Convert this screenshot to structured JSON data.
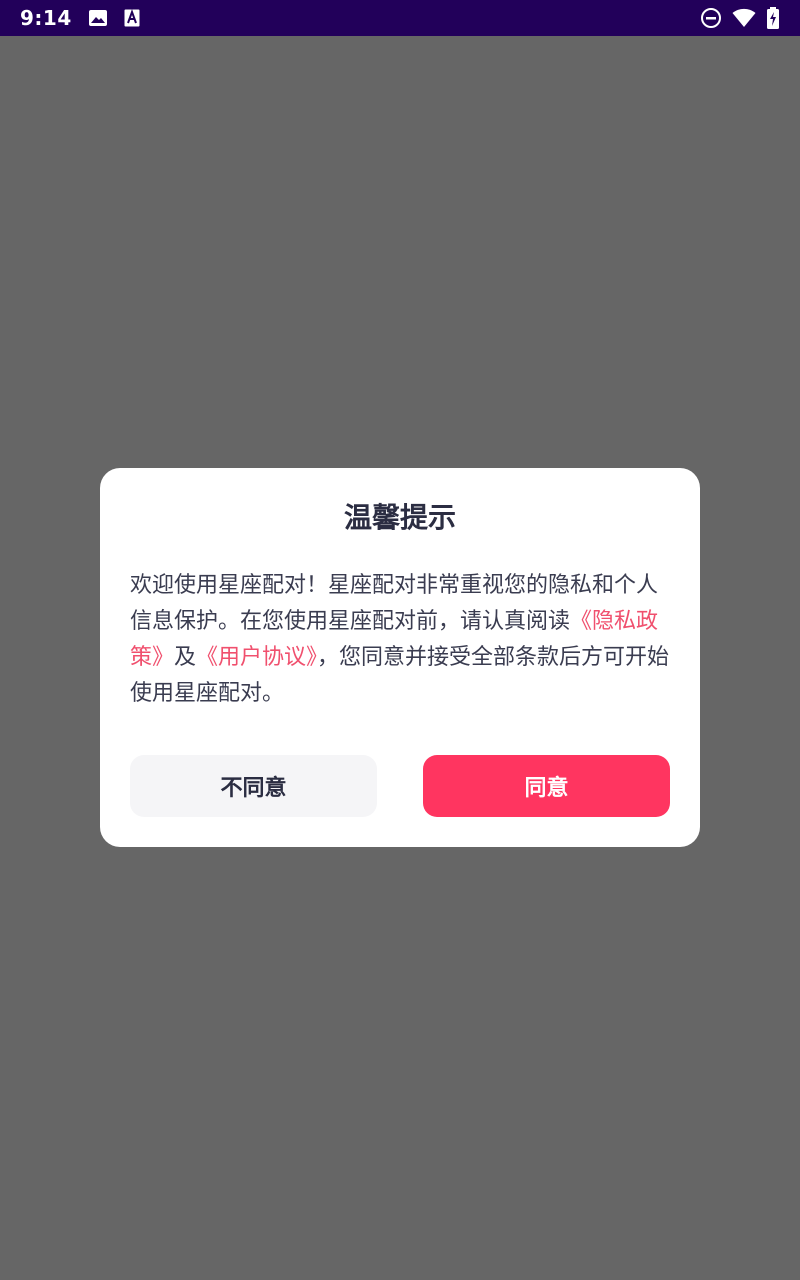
{
  "status_bar": {
    "time": "9:14",
    "left_icons": [
      "image-icon",
      "text-a-icon"
    ],
    "right_icons": [
      "do-not-disturb-icon",
      "wifi-icon",
      "battery-charging-icon"
    ]
  },
  "dialog": {
    "title": "温馨提示",
    "body_prefix": "欢迎使用星座配对！星座配对非常重视您的隐私和个人信息保护。在您使用星座配对前，请认真阅读",
    "privacy_link": "《隐私政策》",
    "body_and": "及",
    "terms_link": "《用户协议》",
    "body_suffix": "，您同意并接受全部条款后方可开始使用星座配对。",
    "disagree_label": "不同意",
    "agree_label": "同意"
  },
  "colors": {
    "status_bar": "#22005a",
    "overlay": "#666666",
    "link": "#f0506e",
    "agree_button": "#ff3560",
    "disagree_button": "#f5f5f7"
  }
}
